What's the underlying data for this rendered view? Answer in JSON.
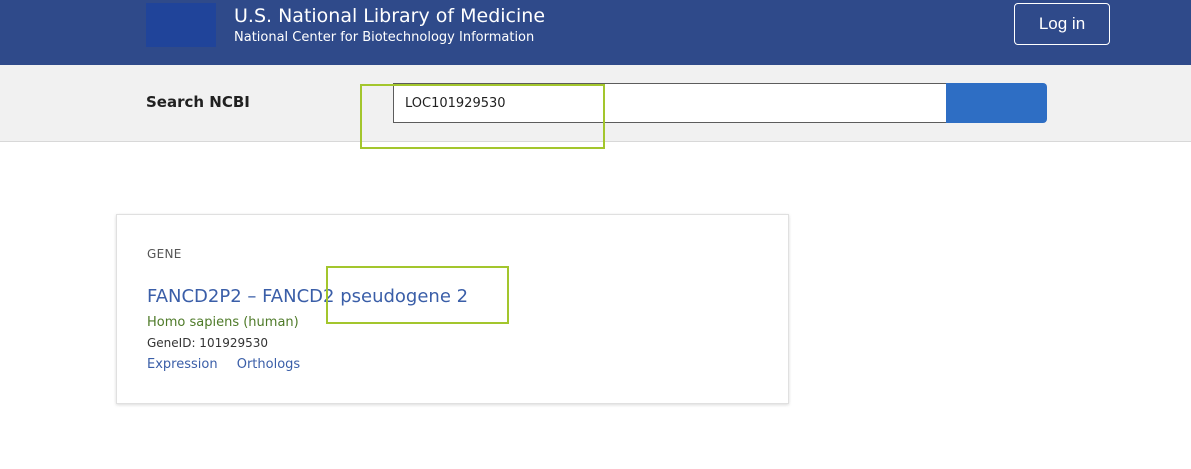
{
  "header": {
    "org_title": "U.S. National Library of Medicine",
    "org_subtitle": "National Center for Biotechnology Information",
    "login_label": "Log in",
    "background_color": "#2f4a8a"
  },
  "search": {
    "label": "Search NCBI",
    "query_value": "LOC101929530",
    "button_color": "#2e6ec4"
  },
  "result": {
    "type_label": "GENE",
    "title": "FANCD2P2  –  FANCD2 pseudogene 2",
    "organism": "Homo sapiens (human)",
    "gene_id": "GeneID: 101929530",
    "links": [
      "Expression",
      "Orthologs"
    ]
  },
  "highlight_color": "#a3c62d"
}
